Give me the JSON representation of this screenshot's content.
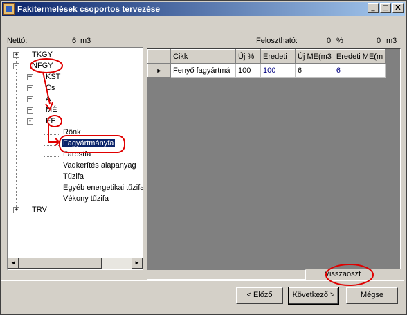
{
  "window": {
    "title": "Fakitermelések csoportos tervezése",
    "buttons": {
      "minimize": "_",
      "maximize": "□",
      "close": "X"
    }
  },
  "summary": {
    "netto_label": "Nettó:",
    "netto_value": "6",
    "netto_unit": "m3",
    "feloszthato_label": "Felosztható:",
    "feloszthato_percent_value": "0",
    "feloszthato_percent_unit": "%",
    "feloszthato_amount_value": "0",
    "feloszthato_amount_unit": "m3"
  },
  "tree": {
    "nodes": [
      {
        "label": "TKGY",
        "expander": "+"
      },
      {
        "label": "NFGY",
        "expander": "-"
      },
      {
        "label": "KST",
        "expander": "+"
      },
      {
        "label": "Cs",
        "expander": "+"
      },
      {
        "label": "A",
        "expander": "+"
      },
      {
        "label": "MÉ",
        "expander": "+"
      },
      {
        "label": "EF",
        "expander": "-"
      },
      {
        "label": "Rönk"
      },
      {
        "label": "Fagyártmányfa",
        "selected": true
      },
      {
        "label": "Farostfa"
      },
      {
        "label": "Vadkerítés alapanyag"
      },
      {
        "label": "Tűzifa"
      },
      {
        "label": "Egyéb energetikai tűzifa"
      },
      {
        "label": "Vékony tűzifa"
      },
      {
        "label": "TRV",
        "expander": "+"
      }
    ],
    "scroll_left": "◄",
    "scroll_right": "►"
  },
  "grid": {
    "columns": [
      "Cikk",
      "Új %",
      "Eredeti",
      "Új ME(m3",
      "Eredeti ME(m"
    ],
    "rows": [
      {
        "marker": "►",
        "cells": [
          "Fenyő fagyártmá",
          "100",
          "100",
          "6",
          "6"
        ]
      }
    ]
  },
  "footer": {
    "visszaoszt": "Visszaoszt",
    "prev": "< Előző",
    "next": "Következő >",
    "cancel": "Mégse"
  },
  "colors": {
    "title_start": "#0a246a",
    "title_end": "#a6caf0",
    "selection": "#0a246a",
    "annotation": "#e00000"
  }
}
